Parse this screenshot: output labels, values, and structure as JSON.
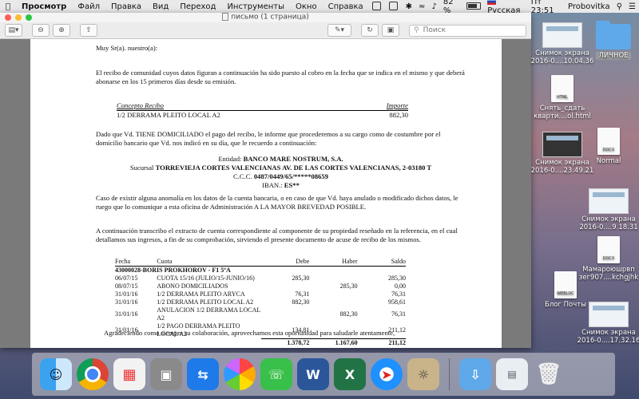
{
  "menubar": {
    "app_name": "Просмотр",
    "menus": [
      "Файл",
      "Правка",
      "Вид",
      "Переход",
      "Инструменты",
      "Окно",
      "Справка"
    ],
    "battery": "82 %",
    "input_lang": "Русская",
    "clock": "Пт 23:51",
    "user": "Probovitka"
  },
  "window": {
    "title": "письмо (1 страница)",
    "search_placeholder": "Поиск"
  },
  "document": {
    "greeting": "Muy Sr(a). nuestro(a):",
    "para1": "El recibo de comunidad cuyos datos figuran a continuación ha sido puesto al cobro en la fecha que se indica en el mismo y que deberá abonarse en los 15 primeros días desde su emisión.",
    "concept_header": "Concepto Recibo",
    "amount_header": "Importe",
    "concept_value": "1/2 DERRAMA PLEITO LOCAL A2",
    "amount_value": "882,30",
    "para2": "Dado que Vd. TIENE DOMICILIADO el pago del recibo, le informe que procederemos a su cargo como de costumbre por el domicilio bancario que Vd. nos indicó en su día, que le recuerdo a continuación:",
    "entity_label": "Entidad:",
    "entity_value": "BANCO MARE NOSTRUM, S.A.",
    "branch_label": "Sucursal",
    "branch_value": "TORREVIEJA CORTES VALENCIANAS AV. DE LAS CORTES VALENCIANAS, 2-03180 T",
    "ccc_label": "C.C.C.",
    "ccc_value": "0487/0449/65/*****08659",
    "iban_label": "IBAN.:",
    "iban_value": "ES**",
    "para3": "Caso de existir alguna anomalía en los datos de la cuenta bancaria, o en caso de que Vd. haya anulado o modificado dichos datos, le ruego que lo comunique a esta oficina de Administración A LA MAYOR BREVEDAD POSIBLE.",
    "para4": "A continuación transcribo el extracto de cuenta correspondiente al componente de su propiedad reseñado en la referencia, en el cual detallamos sus ingresos, a fin de su comprobación, sirviendo el presente documento de acuse de recibo de los mismos.",
    "table": {
      "headers": [
        "Fecha",
        "Cuota",
        "Debe",
        "Haber",
        "Saldo"
      ],
      "owner": "43000028-BORIS PROKHOROV - F1 5ºA",
      "rows": [
        [
          "06/07/15",
          "CUOTA 15/16 (JULIO/15-JUNIO/16)",
          "285,30",
          "",
          "285,30"
        ],
        [
          "08/07/15",
          "ABONO DOMICILIADOS",
          "",
          "285,30",
          "0,00"
        ],
        [
          "31/01/16",
          "1/2 DERRAMA PLEITO ARYCA",
          "76,31",
          "",
          "76,31"
        ],
        [
          "31/01/16",
          "1/2 DERRAMA PLEITO LOCAL A2",
          "882,30",
          "",
          "958,61"
        ],
        [
          "31/01/16",
          "ANULACION 1/2 DERRAMA LOCAL A2",
          "",
          "882,30",
          "76,31"
        ],
        [
          "31/01/16",
          "1/2 PAGO DERRAMA PLEITO LOCAL A2",
          "134,81",
          "",
          "211,12"
        ]
      ],
      "totals": [
        "",
        "",
        "1.378,72",
        "1.167,60",
        "211,12"
      ]
    },
    "closing": "Agradeciendo como siempre su colaboración, aprovechamos esta oportunidad para saludarle atentamente,"
  },
  "desktop": {
    "icons": [
      {
        "label": "Снимок экрана 2016-0....10.04.36"
      },
      {
        "label": "ЛИЧНОЕ"
      },
      {
        "label": "Снять_сдать кварти....ol.html",
        "badge": "HTML"
      },
      {
        "label": "Снимок экрана 2016-0....23.49.21"
      },
      {
        "label": "Normal",
        "badge": "DOCX"
      },
      {
        "label": "Снимок экрана 2016-0....9.18.31"
      },
      {
        "label": "Мамароюшрвп зег907....kchgjhk",
        "badge": "DOCX"
      },
      {
        "label": "Блог Почты",
        "badge": "WEBLOC"
      },
      {
        "label": "Снимок экрана 2016-0....17.32.16"
      }
    ]
  },
  "dock": {
    "apps": [
      "Finder",
      "Chrome",
      "Launchpad",
      "Photo Booth",
      "TeamViewer",
      "Photos",
      "FaceTime",
      "Word",
      "Excel",
      "Safari",
      "Preview",
      "Downloads",
      "Documents",
      "Trash"
    ]
  }
}
